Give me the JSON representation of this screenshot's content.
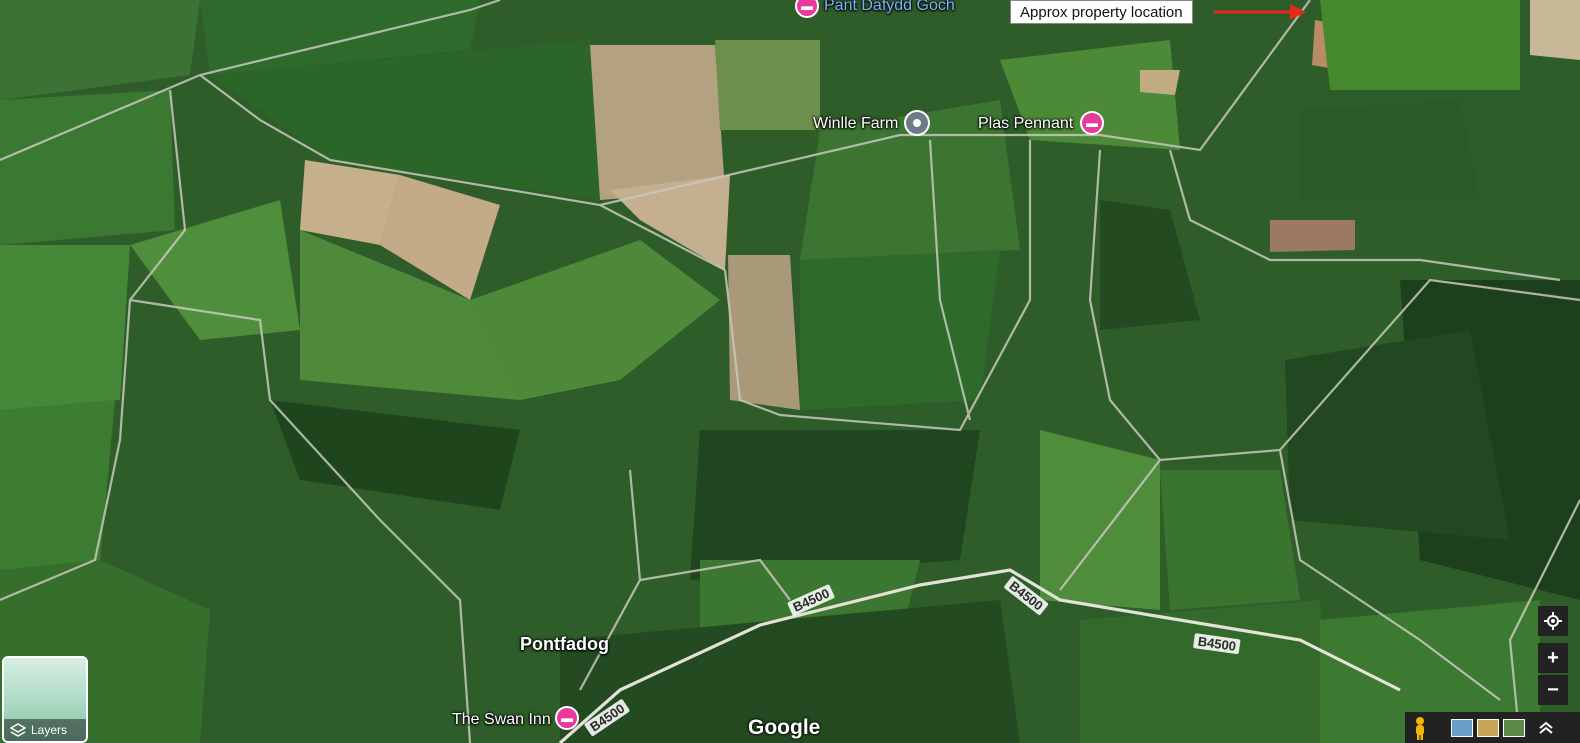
{
  "annotation": {
    "text": "Approx property location",
    "arrow_color": "#e8281b"
  },
  "labels": {
    "pant_dafydd_goch": "Pant Dafydd Goch",
    "winlle_farm": "Winlle Farm",
    "plas_pennant": "Plas Pennant",
    "pontfadog": "Pontfadog",
    "swan_inn": "The Swan Inn"
  },
  "roads": {
    "b4500": "B4500"
  },
  "controls": {
    "layers_label": "Layers",
    "zoom_in": "+",
    "zoom_out": "−"
  },
  "branding": {
    "google": "Google"
  },
  "icons": {
    "hotel_pin": "hotel-pin-icon",
    "place_pin": "place-pin-icon",
    "layers": "layers-icon",
    "locate": "my-location-icon",
    "pegman": "pegman-icon"
  },
  "colors": {
    "hotel_pin": "#e8399c",
    "place_pin": "#6d7d87",
    "field_dark": "#1f4a1f",
    "field_mid": "#3f7a35",
    "field_light": "#69a34c",
    "plowed": "#b6a27b"
  }
}
